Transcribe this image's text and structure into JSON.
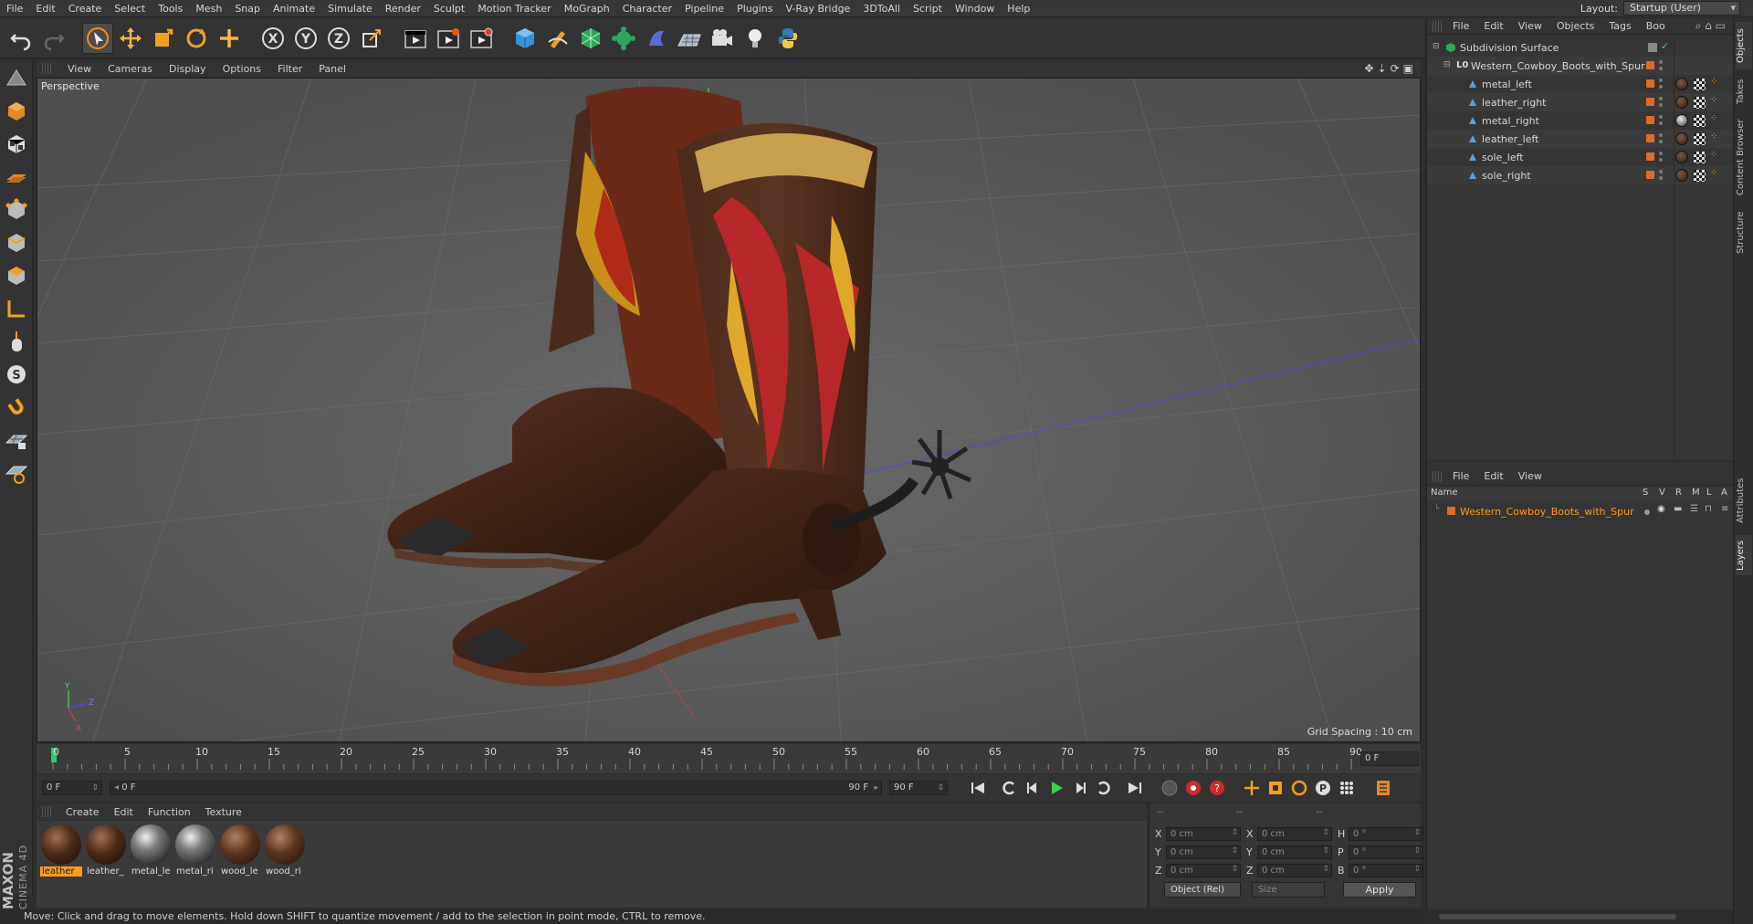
{
  "menubar": {
    "items": [
      "File",
      "Edit",
      "Create",
      "Select",
      "Tools",
      "Mesh",
      "Snap",
      "Animate",
      "Simulate",
      "Render",
      "Sculpt",
      "Motion Tracker",
      "MoGraph",
      "Character",
      "Pipeline",
      "Plugins",
      "V-Ray Bridge",
      "3DToAll",
      "Script",
      "Window",
      "Help"
    ],
    "layout_label": "Layout:",
    "layout_value": "Startup (User)"
  },
  "toolbar": {
    "icons": [
      "undo-icon",
      "redo-icon",
      "select-arrow-icon",
      "move-icon",
      "scale-icon",
      "rotate-icon",
      "move-add-icon",
      "x-axis-icon",
      "y-axis-icon",
      "z-axis-icon",
      "coordinate-system-icon",
      "render-view-icon",
      "render-picture-viewer-icon",
      "render-settings-icon",
      "cube-icon",
      "pen-icon",
      "subdivision-icon",
      "array-icon",
      "deformer-icon",
      "floor-icon",
      "camera-icon",
      "light-icon",
      "python-icon"
    ]
  },
  "viewport": {
    "menu": [
      "View",
      "Cameras",
      "Display",
      "Options",
      "Filter",
      "Panel"
    ],
    "label": "Perspective",
    "grid_spacing": "Grid Spacing : 10 cm",
    "axis_labels": {
      "x": "X",
      "y": "Y",
      "z": "Z"
    }
  },
  "timeline": {
    "ticks": [
      "0",
      "5",
      "10",
      "15",
      "20",
      "25",
      "30",
      "35",
      "40",
      "45",
      "50",
      "55",
      "60",
      "65",
      "70",
      "75",
      "80",
      "85",
      "90"
    ],
    "current_frame": "0 F"
  },
  "transport": {
    "start_field": "0 F",
    "range_start": "0 F",
    "range_end": "90 F",
    "end_field": "90 F"
  },
  "materials": {
    "menu": [
      "Create",
      "Edit",
      "Function",
      "Texture"
    ],
    "items": [
      {
        "label": "leather",
        "kind": "leather",
        "selected": true
      },
      {
        "label": "leather_",
        "kind": "leather",
        "selected": false
      },
      {
        "label": "metal_le",
        "kind": "metal",
        "selected": false
      },
      {
        "label": "metal_ri",
        "kind": "metal",
        "selected": false
      },
      {
        "label": "wood_le",
        "kind": "leather",
        "selected": false
      },
      {
        "label": "wood_ri",
        "kind": "leather",
        "selected": false
      }
    ]
  },
  "coords": {
    "headers": [
      "--",
      "--",
      "--"
    ],
    "rows": [
      {
        "a1": "X",
        "v1": "0 cm",
        "a2": "X",
        "v2": "0 cm",
        "a3": "H",
        "v3": "0 °"
      },
      {
        "a1": "Y",
        "v1": "0 cm",
        "a2": "Y",
        "v2": "0 cm",
        "a3": "P",
        "v3": "0 °"
      },
      {
        "a1": "Z",
        "v1": "0 cm",
        "a2": "Z",
        "v2": "0 cm",
        "a3": "B",
        "v3": "0 °"
      }
    ],
    "mode": "Object (Rel)",
    "size": "Size",
    "apply": "Apply"
  },
  "status": "Move: Click and drag to move elements. Hold down SHIFT to quantize movement / add to the selection in point mode, CTRL to remove.",
  "objects_panel": {
    "menu": [
      "File",
      "Edit",
      "View",
      "Objects",
      "Tags",
      "Boo"
    ],
    "items": [
      {
        "name": "Subdivision Surface",
        "level": 0
      },
      {
        "name": "Western_Cowboy_Boots_with_Spur",
        "level": 1
      },
      {
        "name": "metal_left",
        "level": 2
      },
      {
        "name": "leather_right",
        "level": 2
      },
      {
        "name": "metal_right",
        "level": 2
      },
      {
        "name": "leather_left",
        "level": 2
      },
      {
        "name": "sole_left",
        "level": 2
      },
      {
        "name": "sole_right",
        "level": 2
      }
    ]
  },
  "layers_panel": {
    "menu": [
      "File",
      "Edit",
      "View"
    ],
    "header_name": "Name",
    "header_cols": [
      "S",
      "V",
      "R",
      "M",
      "L",
      "A"
    ],
    "items": [
      "Western_Cowboy_Boots_with_Spur"
    ]
  },
  "right_tabs": [
    "Objects",
    "Takes",
    "Content Browser",
    "Structure",
    "Attributes",
    "Layers"
  ],
  "colors": {
    "accent_orange": "#ff9c1a",
    "layer_orange": "#e06a2a",
    "timeline_marker": "#2ecc71"
  }
}
